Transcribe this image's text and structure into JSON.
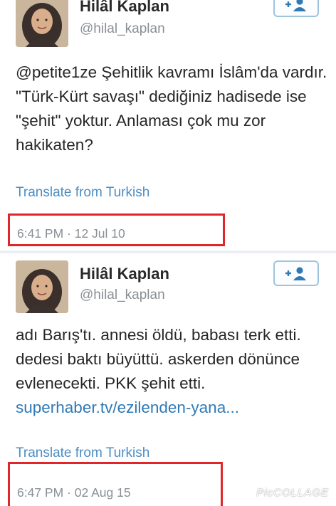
{
  "tweets": [
    {
      "name": "Hilâl Kaplan",
      "handle": "@hilal_kaplan",
      "text": "@petite1ze Şehitlik kavramı İslâm'da vardır. \"Türk-Kürt savaşı\" dediğiniz hadisede ise \"şehit\" yoktur. Anlaması çok mu zor hakikaten?",
      "translate": "Translate from Turkish",
      "timestamp": "6:41 PM · 12 Jul 10"
    },
    {
      "name": "Hilâl Kaplan",
      "handle": "@hilal_kaplan",
      "text": "adı Barış'tı. annesi öldü, babası terk etti. dedesi baktı büyüttü. askerden dönünce evlenecekti. PKK şehit etti.",
      "link": "superhaber.tv/ezilenden-yana...",
      "translate": "Translate from Turkish",
      "timestamp": "6:47 PM · 02 Aug 15"
    }
  ],
  "watermark": "PicCOLLAGE",
  "colors": {
    "link": "#2f79b6",
    "translate": "#4c8dc2",
    "highlight": "#e0262b",
    "follow_border": "#9ec4dd"
  },
  "icons": {
    "follow": "add-user-icon",
    "avatar": "profile-photo"
  }
}
